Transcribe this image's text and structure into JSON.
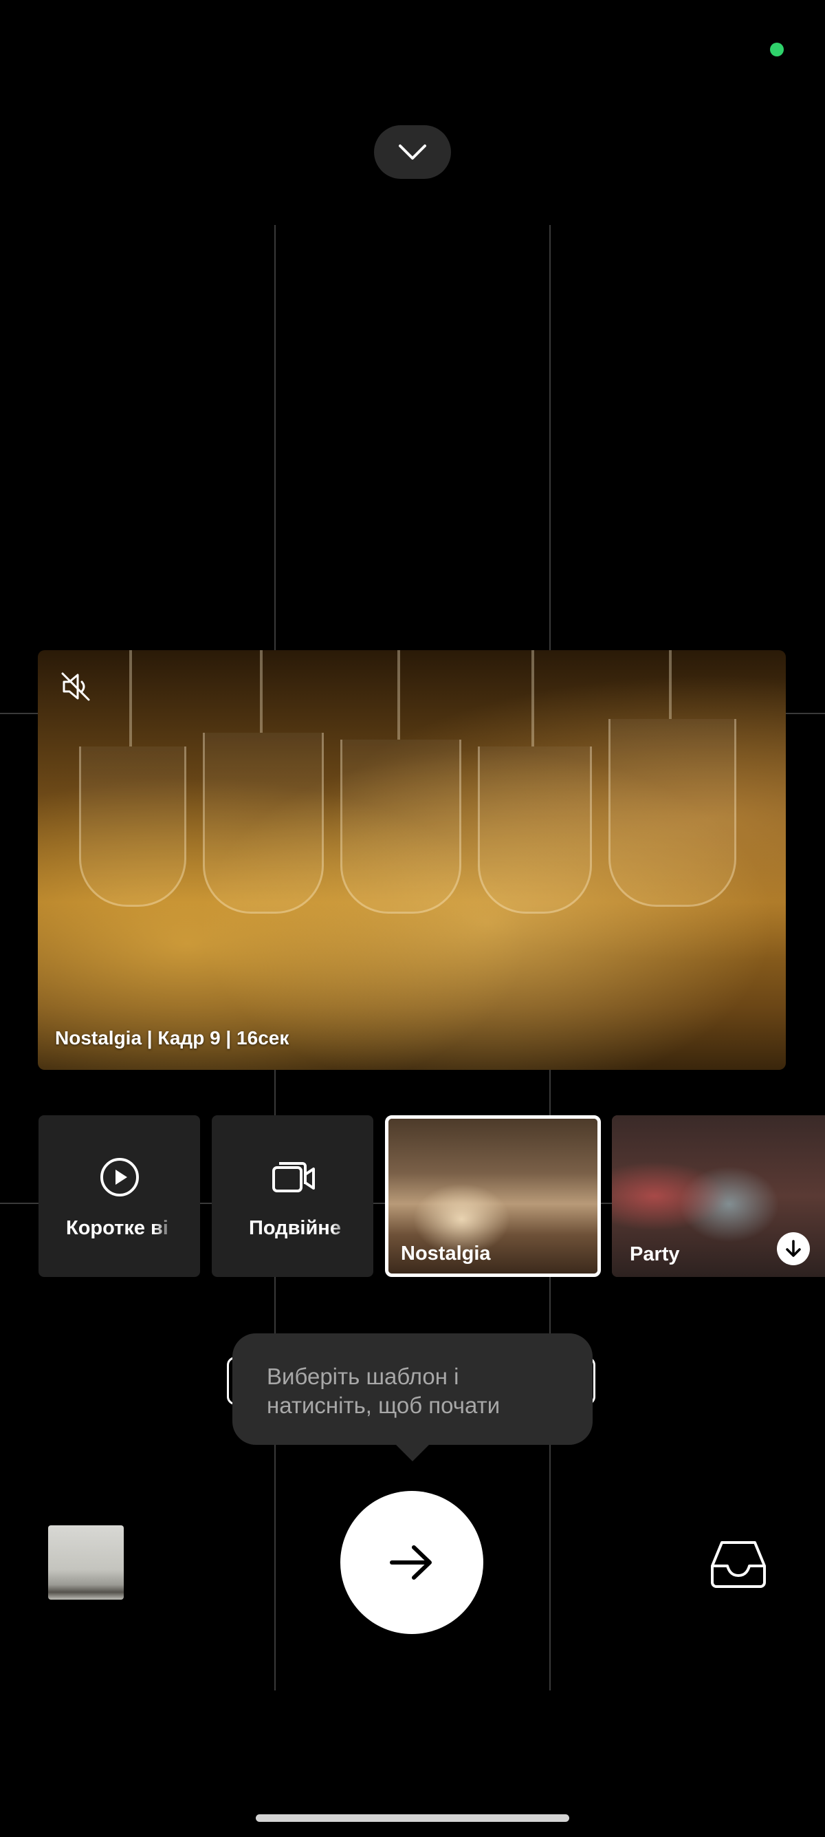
{
  "preview": {
    "caption": "Nostalgia | Кадр 9 | 16сек",
    "muted": true
  },
  "templates": [
    {
      "label": "Коротке ві",
      "icon": "play-circle-icon",
      "selected": false
    },
    {
      "label": "Подвійне",
      "icon": "dual-camera-icon",
      "selected": false
    },
    {
      "label": "Nostalgia",
      "selected": true
    },
    {
      "label": "Party",
      "download_available": true,
      "selected": false
    }
  ],
  "tooltip": {
    "line1": "Виберіть шаблон і",
    "line2": "натисніть, щоб почати"
  },
  "colors": {
    "status_dot": "#2fd26b",
    "background": "#000000",
    "tooltip_bg": "#2c2c2c"
  }
}
